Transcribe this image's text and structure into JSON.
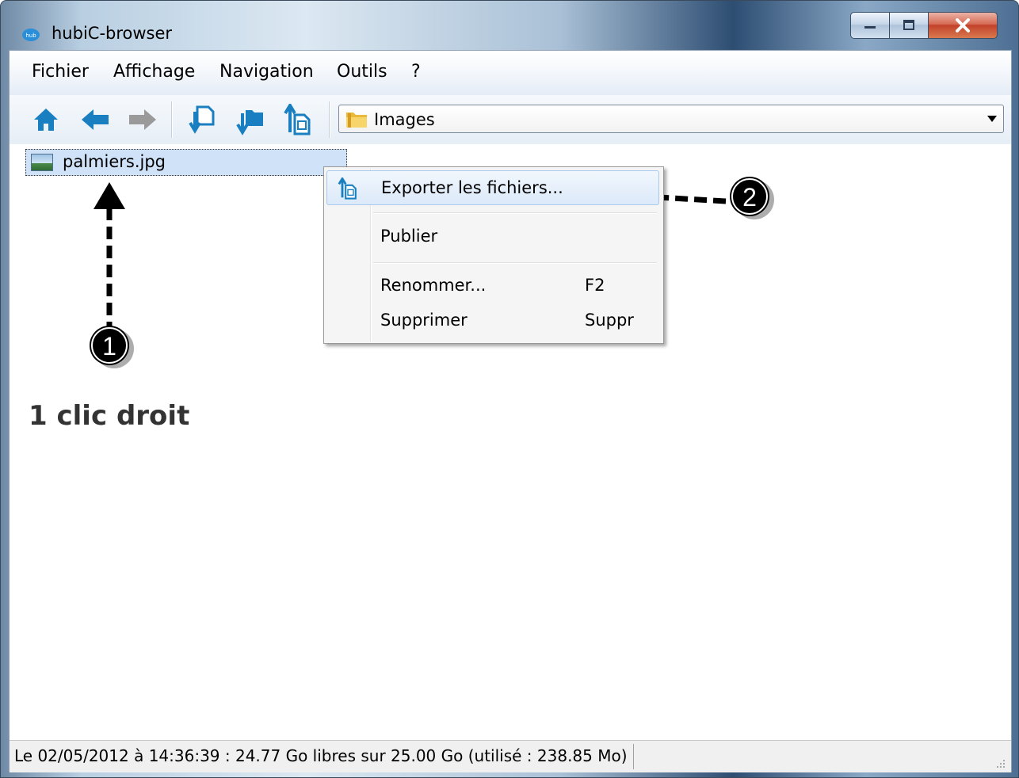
{
  "window": {
    "title": "hubiC-browser",
    "controls": {
      "minimize": "minimize",
      "maximize": "maximize",
      "close": "close"
    }
  },
  "menubar": {
    "items": [
      "Fichier",
      "Affichage",
      "Navigation",
      "Outils",
      "?"
    ]
  },
  "toolbar": {
    "buttons": [
      "home-icon",
      "back-arrow-icon",
      "forward-arrow-icon",
      "download-file-icon",
      "download-folder-icon",
      "export-icon"
    ],
    "location": "Images"
  },
  "content": {
    "file": {
      "name": "palmiers.jpg"
    }
  },
  "context_menu": {
    "items": [
      {
        "label": "Exporter les fichiers...",
        "shortcut": ""
      },
      {
        "label": "Publier",
        "shortcut": ""
      },
      {
        "label": "Renommer...",
        "shortcut": "F2"
      },
      {
        "label": "Supprimer",
        "shortcut": "Suppr"
      }
    ]
  },
  "annotations": {
    "step1": "1",
    "step2": "2",
    "caption": "1 clic droit"
  },
  "statusbar": {
    "text": "Le 02/05/2012 à 14:36:39 : 24.77 Go libres sur 25.00 Go (utilisé : 238.85 Mo)"
  },
  "colors": {
    "toolbar_icon_blue": "#1a7fc0",
    "disabled_gray": "#9a9a9a",
    "close_red": "#c2422a",
    "selection": "#cfe2f8"
  }
}
